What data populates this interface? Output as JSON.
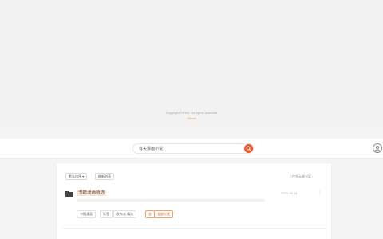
{
  "footer": {
    "copyright": "Copyright ©PHA · All rights reserved",
    "link": "Github"
  },
  "search": {
    "query": "有关漫画小说"
  },
  "toolbar": {
    "sort_label": "默认排序 ▾",
    "refresh_label": "刷新列表",
    "right_link": "上传到云端书架 ›"
  },
  "result": {
    "title": "书籍漫画精选",
    "date": "2023-08-14",
    "more": "⋮"
  },
  "filters": [
    {
      "label": "书籍漫画",
      "active": false
    },
    {
      "label": "标签",
      "active": false
    },
    {
      "label": "发布者 精选",
      "active": false
    },
    {
      "label": "全",
      "active": true
    },
    {
      "label": "全部分类",
      "active": true
    }
  ],
  "colors": {
    "accent": "#e8572b",
    "highlight": "#fbe3cf"
  }
}
